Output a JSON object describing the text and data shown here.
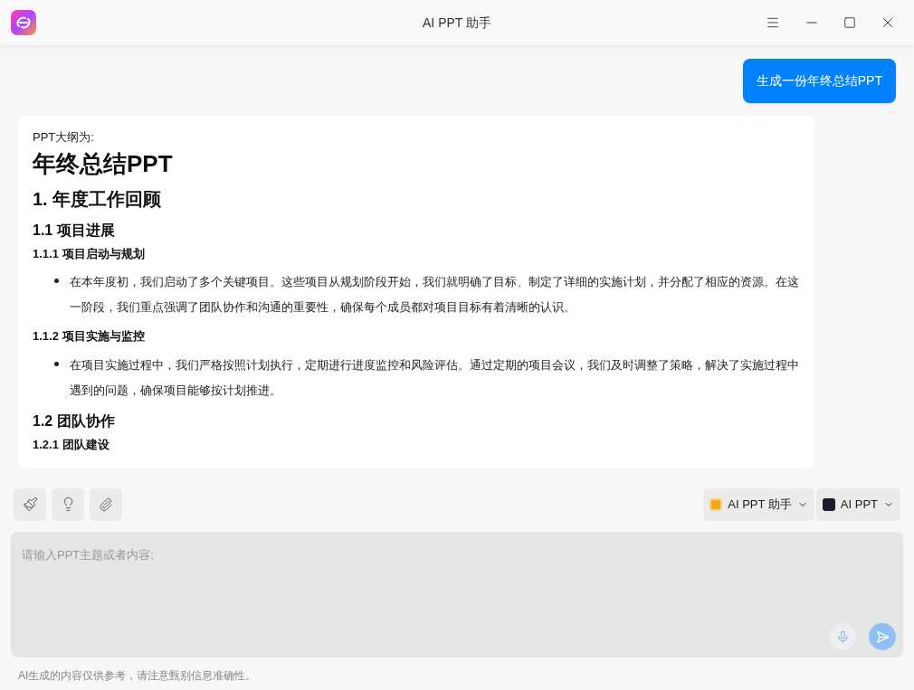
{
  "window": {
    "title": "AI PPT 助手"
  },
  "user_message": "生成一份年终总结PPT",
  "reply": {
    "intro": "PPT大纲为:",
    "blocks": [
      {
        "kind": "h1",
        "text": "年终总结PPT"
      },
      {
        "kind": "h2",
        "text": "1. 年度工作回顾"
      },
      {
        "kind": "h3",
        "text": "1.1 项目进展"
      },
      {
        "kind": "h4",
        "text": "1.1.1 项目启动与规划"
      },
      {
        "kind": "bullet",
        "text": "在本年度初，我们启动了多个关键项目。这些项目从规划阶段开始，我们就明确了目标、制定了详细的实施计划，并分配了相应的资源。在这一阶段，我们重点强调了团队协作和沟通的重要性，确保每个成员都对项目目标有着清晰的认识。"
      },
      {
        "kind": "h4",
        "text": "1.1.2 项目实施与监控"
      },
      {
        "kind": "bullet",
        "text": "在项目实施过程中，我们严格按照计划执行，定期进行进度监控和风险评估。通过定期的项目会议，我们及时调整了策略，解决了实施过程中遇到的问题，确保项目能够按计划推进。"
      },
      {
        "kind": "h3",
        "text": "1.2 团队协作"
      },
      {
        "kind": "h4",
        "text": "1.2.1 团队建设"
      }
    ]
  },
  "selectors": [
    {
      "label": "AI PPT 助手",
      "kind": "assistant"
    },
    {
      "label": "AI PPT",
      "kind": "model"
    }
  ],
  "input": {
    "placeholder": "请输入PPT主题或者内容;"
  },
  "disclaimer": "AI生成的内容仅供参考，请注意甄别信息准确性。"
}
